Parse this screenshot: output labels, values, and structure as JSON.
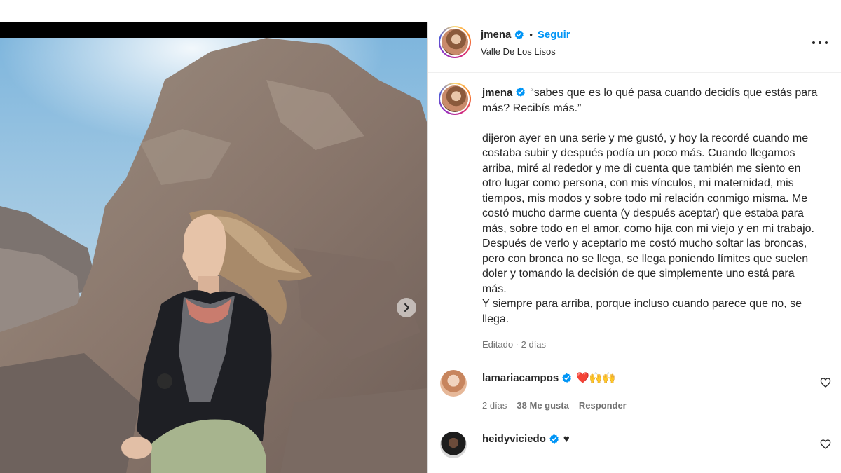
{
  "post": {
    "username": "jmena",
    "follow_label": "Seguir",
    "separator": "•",
    "location": "Valle De Los Lisos"
  },
  "caption": {
    "username": "jmena",
    "text": "“sabes que es lo qué pasa cuando decidís que estás para más? Recibís más.”\n\ndijeron ayer en una serie y me gustó, y hoy la recordé cuando me costaba subir y después podía un poco más. Cuando llegamos arriba, miré al rededor y me di cuenta que también me siento en otro lugar como persona, con mis vínculos, mi maternidad, mis tiempos, mis modos y sobre todo mi relación conmigo misma. Me costó mucho darme cuenta (y después aceptar) que estaba para más, sobre todo en el amor, como hija con mi viejo y en mi trabajo. Después de verlo y aceptarlo me costó mucho soltar las broncas, pero con bronca no se llega, se llega poniendo límites que suelen doler y tomando la decisión de que simplemente uno está para más.\nY siempre para arriba, porque incluso cuando parece que no, se llega.",
    "edited": "Editado · 2 días"
  },
  "comments": [
    {
      "username": "lamariacampos",
      "text": "❤️🙌🙌",
      "time": "2 días",
      "likes": "38 Me gusta",
      "reply_label": "Responder"
    },
    {
      "username": "heidyviciedo",
      "text": "♥"
    }
  ],
  "colors": {
    "accent": "#0095f6",
    "verified": "#0095f6",
    "muted": "#737373"
  },
  "icons": [
    "verified-badge-icon",
    "more-options-icon",
    "carousel-next-icon",
    "heart-outline-icon"
  ]
}
